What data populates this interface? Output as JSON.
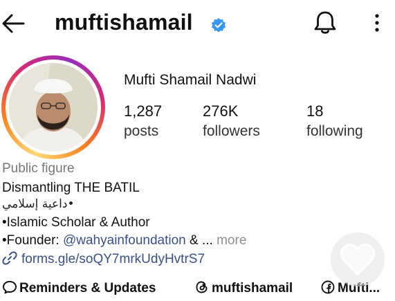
{
  "header": {
    "username": "muftishamail",
    "verified_color": "#3897f0",
    "icons": [
      "back-arrow-icon",
      "verified-badge-icon",
      "bell-icon",
      "more-vertical-icon"
    ]
  },
  "profile": {
    "full_name": "Mufti Shamail Nadwi",
    "stats": {
      "posts_count": "1,287",
      "posts_label": "posts",
      "followers_count": "276K",
      "followers_label": "followers",
      "following_count": "18",
      "following_label": "following"
    }
  },
  "bio": {
    "category": "Public figure",
    "line1": "Dismantling THE BATIL",
    "line2": "•داعية إسلامي",
    "line3": "•Islamic Scholar & Author",
    "line4_prefix": "•Founder: ",
    "line4_mention": "@wahyainfoundation",
    "line4_suffix": " & ...",
    "more_label": "more",
    "link": "forms.gle/soQY7mrkUdyHvtrS7"
  },
  "chips": {
    "chip1": "Reminders & Updates",
    "chip2": "muftishamail",
    "chip3": "Mufti..."
  },
  "colors": {
    "link": "#385185",
    "ring_gradient": [
      "#feda75",
      "#fa7e1e",
      "#d62976",
      "#962fbf"
    ]
  }
}
